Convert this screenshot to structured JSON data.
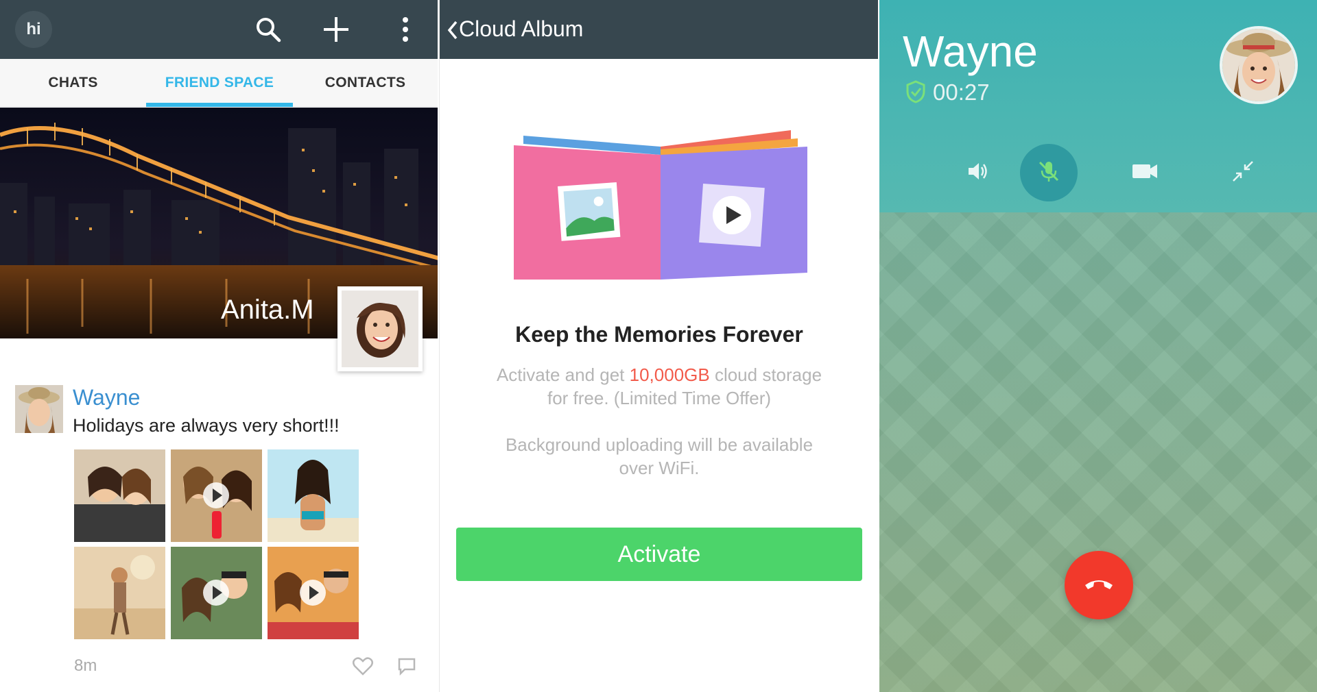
{
  "friend_app": {
    "logo_text": "hi",
    "tabs": [
      {
        "label": "CHATS",
        "active": false
      },
      {
        "label": "FRIEND SPACE",
        "active": true
      },
      {
        "label": "CONTACTS",
        "active": false
      }
    ],
    "cover_name": "Anita.M",
    "post": {
      "author": "Wayne",
      "text": "Holidays are always very short!!!",
      "photos": [
        {
          "kind": "photo"
        },
        {
          "kind": "video"
        },
        {
          "kind": "photo"
        },
        {
          "kind": "photo"
        },
        {
          "kind": "video"
        },
        {
          "kind": "video"
        }
      ],
      "time": "8m"
    },
    "icons": [
      "search-icon",
      "plus-icon",
      "overflow-menu-icon",
      "heart-icon",
      "comment-icon"
    ],
    "accent_color": "#34b7e8"
  },
  "cloud_album": {
    "title": "Cloud Album",
    "heading": "Keep the Memories Forever",
    "line1_prefix": "Activate and get ",
    "line1_highlight": "10,000GB",
    "line1_suffix": " cloud storage",
    "line2": "for free. (Limited Time Offer)",
    "line3": "Background uploading will be available",
    "line4": "over WiFi.",
    "activate_label": "Activate",
    "button_color": "#4cd46a",
    "highlight_color": "#f25a4a"
  },
  "call": {
    "caller_name": "Wayne",
    "timer": "00:27",
    "controls": [
      {
        "icon": "speaker-icon",
        "active": false
      },
      {
        "icon": "mute-mic-icon",
        "active": true
      },
      {
        "icon": "video-camera-icon",
        "active": false
      },
      {
        "icon": "minimize-icon",
        "active": false
      }
    ],
    "hangup_color": "#f2392b"
  }
}
